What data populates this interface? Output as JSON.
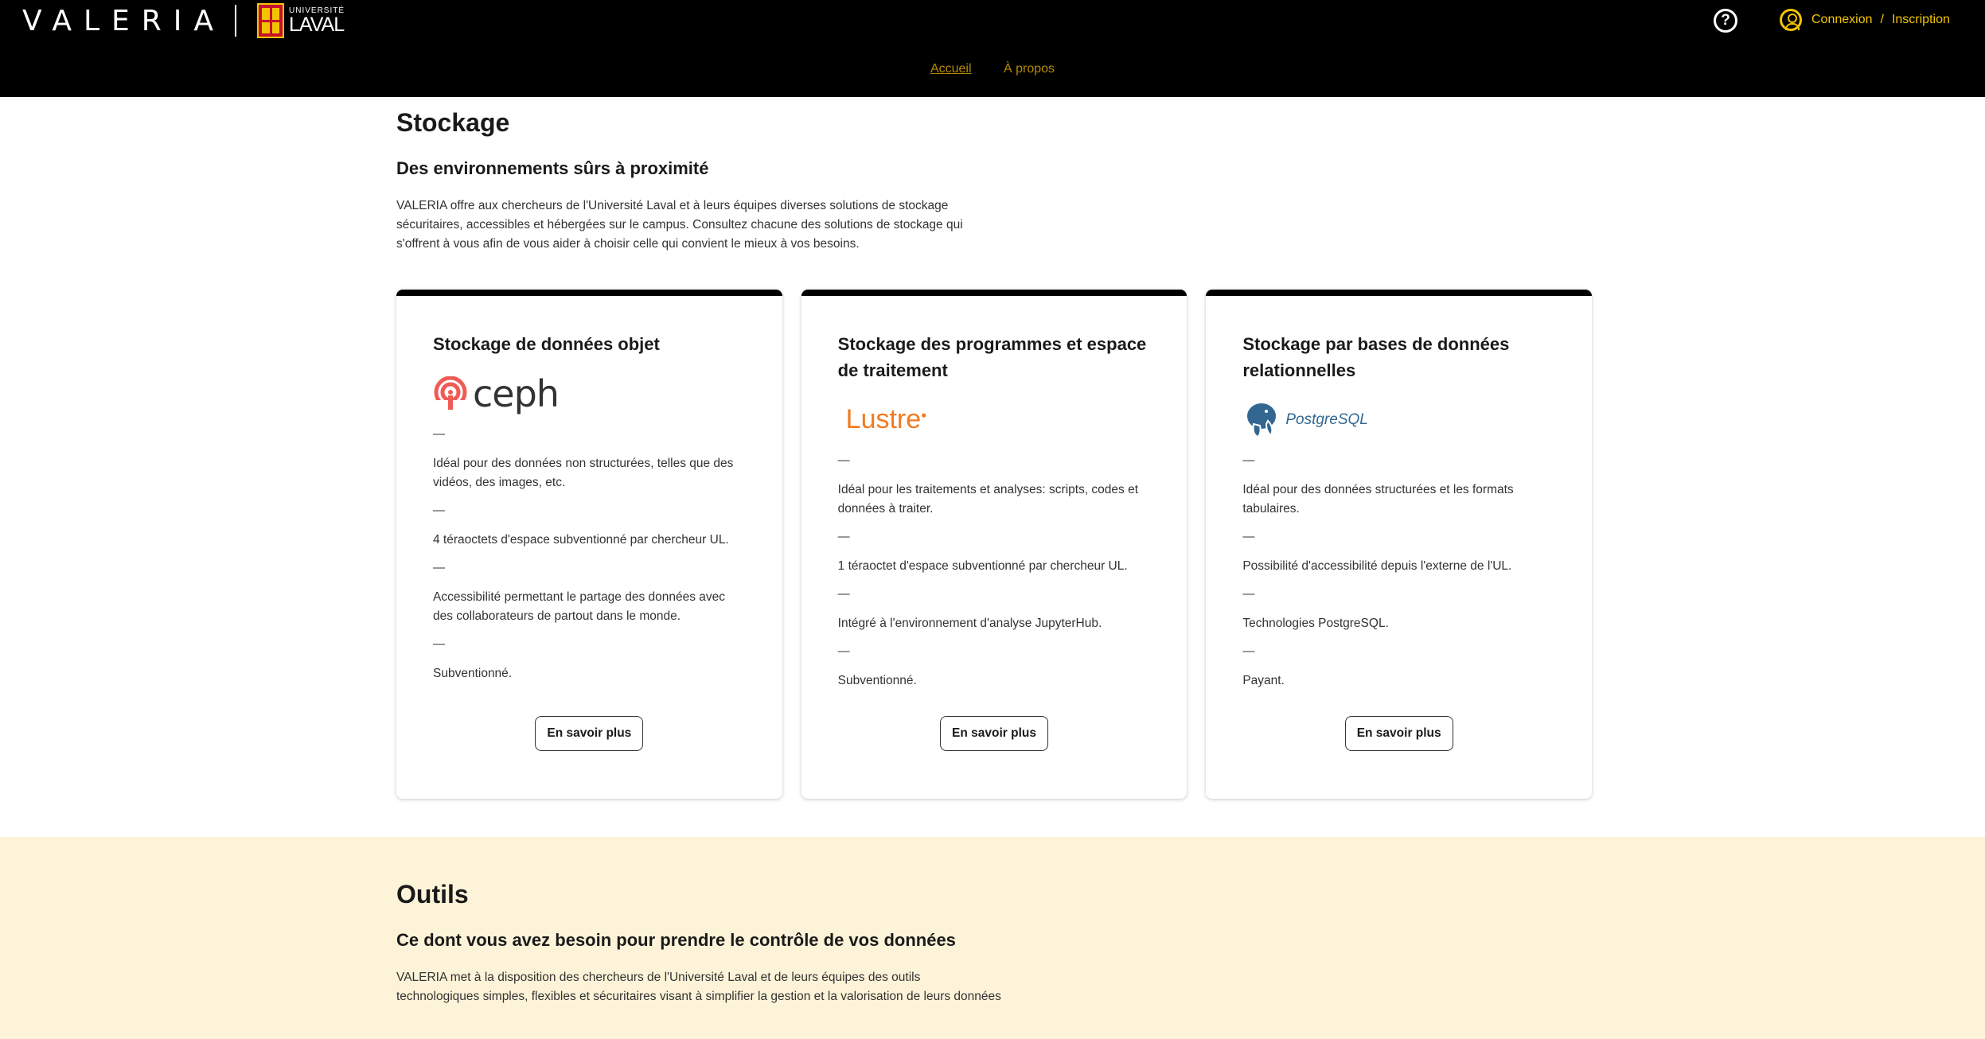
{
  "header": {
    "brand": "VALERIA",
    "ul_logo": {
      "small": "UNIVERSITÉ",
      "big": "LAVAL"
    },
    "help_icon": "question-circle-icon",
    "account": {
      "login": "Connexion",
      "separator": "/",
      "signup": "Inscription",
      "icon": "user-circle-icon"
    },
    "nav": [
      {
        "label": "Accueil",
        "active": true
      },
      {
        "label": "À propos",
        "active": false
      }
    ],
    "colors": {
      "background": "#000000",
      "accent": "#f2c400"
    }
  },
  "stockage": {
    "title": "Stockage",
    "subtitle": "Des environnements sûrs à proximité",
    "description": "VALERIA offre aux chercheurs de l'Université Laval et à leurs équipes diverses solutions de stockage sécuritaires, accessibles et hébergées sur le campus. Consultez chacune des solutions de stockage qui s'offrent à vous afin de vous aider à choisir celle qui convient le mieux à vos besoins.",
    "cards": [
      {
        "title": "Stockage de données objet",
        "logo": "ceph",
        "features": [
          "Idéal pour des données non structurées, telles que des vidéos, des images, etc.",
          "4 téraoctets d'espace subventionné par chercheur UL.",
          "Accessibilité permettant le partage des données avec des collaborateurs de partout dans le monde.",
          "Subventionné."
        ],
        "button": "En savoir plus"
      },
      {
        "title": "Stockage des programmes et espace de traitement",
        "logo": "Lustre",
        "features": [
          "Idéal pour les traitements et analyses: scripts, codes et données à traiter.",
          "1 téraoctet d'espace subventionné par chercheur UL.",
          "Intégré à l'environnement d'analyse JupyterHub.",
          "Subventionné."
        ],
        "button": "En savoir plus"
      },
      {
        "title": "Stockage par bases de données relationnelles",
        "logo": "PostgreSQL",
        "features": [
          "Idéal pour des données structurées et les formats tabulaires.",
          "Possibilité d'accessibilité depuis l'externe de l'UL.",
          "Technologies PostgreSQL.",
          "Payant."
        ],
        "button": "En savoir plus"
      }
    ],
    "dash": "—"
  },
  "outils": {
    "title": "Outils",
    "subtitle": "Ce dont vous avez besoin pour prendre le contrôle de vos données",
    "description": "VALERIA met à la disposition des chercheurs de l'Université Laval et de leurs équipes des outils technologiques simples, flexibles et sécuritaires visant à simplifier la gestion et la valorisation de leurs données",
    "background": "#fdf3d8"
  }
}
